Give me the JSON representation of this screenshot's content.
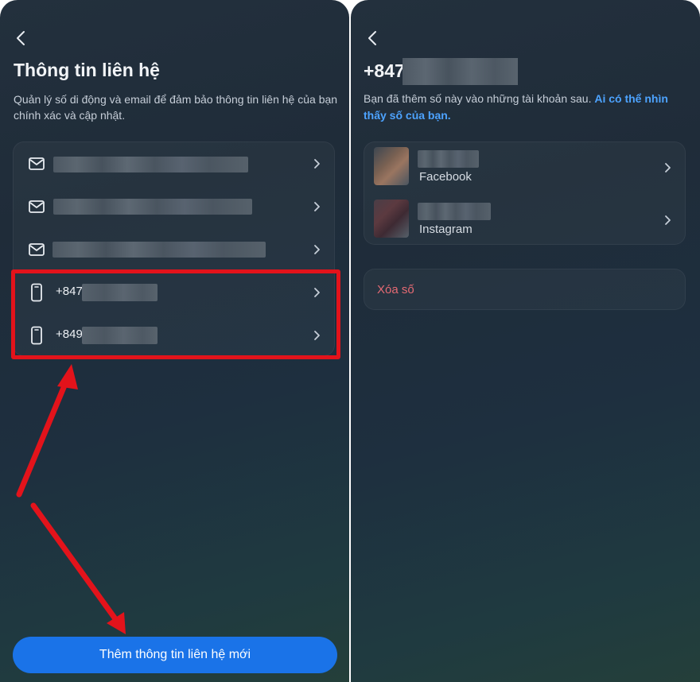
{
  "left": {
    "title": "Thông tin liên hệ",
    "description": "Quản lý số di động và email để đảm bảo thông tin liên hệ của bạn chính xác và cập nhật.",
    "contacts": [
      {
        "type": "email",
        "icon": "mail-icon",
        "value": ""
      },
      {
        "type": "email",
        "icon": "mail-icon",
        "value": ""
      },
      {
        "type": "email",
        "icon": "mail-icon",
        "value": ""
      },
      {
        "type": "phone",
        "icon": "phone-icon",
        "value": "+847"
      },
      {
        "type": "phone",
        "icon": "phone-icon",
        "value": "+849"
      }
    ],
    "add_button_label": "Thêm thông tin liên hệ mới"
  },
  "right": {
    "phone_title": "+847",
    "description": "Bạn đã thêm số này vào những tài khoản sau.",
    "description_link": "Ai có thể nhìn thấy số của bạn.",
    "accounts": [
      {
        "platform": "Facebook",
        "icon": "avatar"
      },
      {
        "platform": "Instagram",
        "icon": "avatar"
      }
    ],
    "delete_label": "Xóa số"
  },
  "colors": {
    "background_top": "#23303d",
    "background_bottom": "#243f3a",
    "primary_button": "#1a73e8",
    "link": "#4da3ff",
    "danger": "#e56a73",
    "annotation": "#e3131b"
  }
}
